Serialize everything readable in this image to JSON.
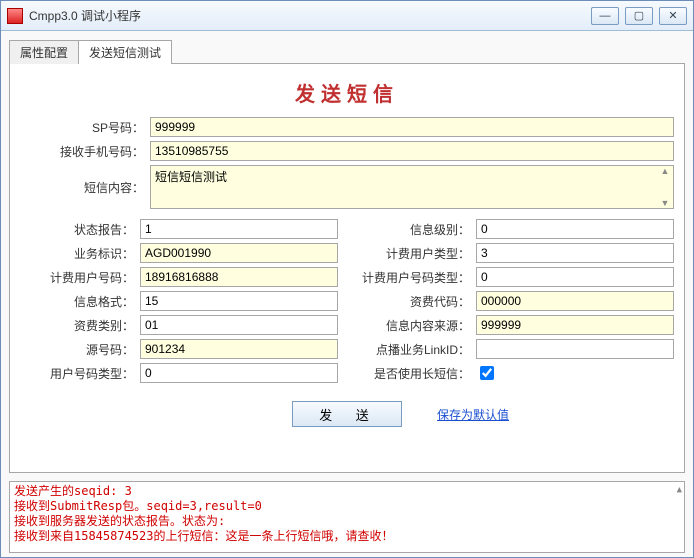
{
  "window": {
    "title": "Cmpp3.0 调试小程序",
    "min": "—",
    "max": "▢",
    "close": "✕"
  },
  "tabs": {
    "attr": "属性配置",
    "send": "发送短信测试"
  },
  "heading": "发送短信",
  "fields": {
    "sp_label": "SP号码：",
    "sp_value": "999999",
    "phone_label": "接收手机号码：",
    "phone_value": "13510985755",
    "content_label": "短信内容：",
    "content_value": "短信短信测试",
    "status_label": "状态报告：",
    "status_value": "1",
    "bizid_label": "业务标识：",
    "bizid_value": "AGD001990",
    "feeuser_label": "计费用户号码：",
    "feeuser_value": "18916816888",
    "msgfmt_label": "信息格式：",
    "msgfmt_value": "15",
    "feetype_label": "资费类别：",
    "feetype_value": "01",
    "srcnum_label": "源号码：",
    "srcnum_value": "901234",
    "usernumtype_label": "用户号码类型：",
    "usernumtype_value": "0",
    "msglevel_label": "信息级别：",
    "msglevel_value": "0",
    "feeusertype_label": "计费用户类型：",
    "feeusertype_value": "3",
    "feeusernumtype_label": "计费用户号码类型：",
    "feeusernumtype_value": "0",
    "feecode_label": "资费代码：",
    "feecode_value": "000000",
    "msgsrc_label": "信息内容来源：",
    "msgsrc_value": "999999",
    "linkid_label": "点播业务LinkID：",
    "linkid_value": "",
    "longsms_label": "是否使用长短信："
  },
  "buttons": {
    "send": "发 送",
    "save": "保存为默认值"
  },
  "log": {
    "l1": "发送产生的seqid: 3",
    "l2": "接收到SubmitResp包。seqid=3,result=0",
    "l3": "接收到服务器发送的状态报告。状态为:",
    "l4": "接收到来自15845874523的上行短信：这是一条上行短信哦，请查收！"
  }
}
